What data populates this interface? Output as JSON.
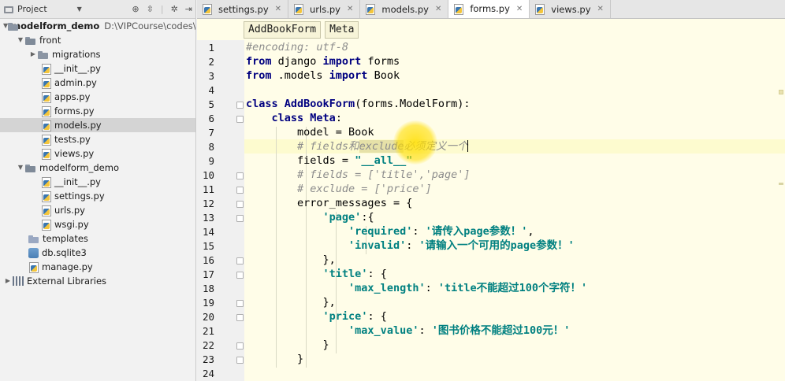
{
  "project_pane": {
    "title": "Project",
    "tree": [
      {
        "label": "modelform_demo",
        "path": "D:\\VIPCourse\\codes\\py",
        "kind": "root",
        "expanded": true
      },
      {
        "label": "front",
        "kind": "package",
        "expanded": true
      },
      {
        "label": "migrations",
        "kind": "folder",
        "expanded": false
      },
      {
        "label": "__init__.py",
        "kind": "py"
      },
      {
        "label": "admin.py",
        "kind": "py"
      },
      {
        "label": "apps.py",
        "kind": "py"
      },
      {
        "label": "forms.py",
        "kind": "py"
      },
      {
        "label": "models.py",
        "kind": "py",
        "selected": true
      },
      {
        "label": "tests.py",
        "kind": "py"
      },
      {
        "label": "views.py",
        "kind": "py"
      },
      {
        "label": "modelform_demo",
        "kind": "package",
        "expanded": true
      },
      {
        "label": "__init__.py",
        "kind": "py"
      },
      {
        "label": "settings.py",
        "kind": "py"
      },
      {
        "label": "urls.py",
        "kind": "py"
      },
      {
        "label": "wsgi.py",
        "kind": "py"
      },
      {
        "label": "templates",
        "kind": "folder-plain"
      },
      {
        "label": "db.sqlite3",
        "kind": "db"
      },
      {
        "label": "manage.py",
        "kind": "py"
      },
      {
        "label": "External Libraries",
        "kind": "libs",
        "expanded": false
      }
    ]
  },
  "tabs": [
    {
      "label": "settings.py",
      "active": false
    },
    {
      "label": "urls.py",
      "active": false
    },
    {
      "label": "models.py",
      "active": false
    },
    {
      "label": "forms.py",
      "active": true
    },
    {
      "label": "views.py",
      "active": false
    }
  ],
  "breadcrumb": [
    "AddBookForm",
    "Meta"
  ],
  "editor": {
    "line_numbers": [
      "1",
      "2",
      "3",
      "4",
      "5",
      "6",
      "7",
      "8",
      "9",
      "10",
      "11",
      "12",
      "13",
      "14",
      "15",
      "16",
      "17",
      "18",
      "19",
      "20",
      "21",
      "22",
      "23",
      "24"
    ],
    "lines": [
      "#encoding: utf-8",
      "from django import forms",
      "from .models import Book",
      "",
      "class AddBookForm(forms.ModelForm):",
      "    class Meta:",
      "        model = Book",
      "        # fields和exclude必须定义一个",
      "        fields = \"__all__\"",
      "        # fields = ['title','page']",
      "        # exclude = ['price']",
      "        error_messages = {",
      "            'page':{",
      "                'required': '请传入page参数！',",
      "                'invalid': '请输入一个可用的page参数！'",
      "            },",
      "            'title': {",
      "                'max_length': 'title不能超过100个字符！'",
      "            },",
      "            'price': {",
      "                'max_value': '图书价格不能超过100元！'",
      "            }",
      "        }",
      ""
    ],
    "tokens": {
      "l1_comment": "#encoding: utf-8",
      "kw_from": "from",
      "kw_import": "import",
      "kw_class": "class",
      "mod_django": " django ",
      "mod_forms": " forms",
      "mod_models": " .models ",
      "name_book": " Book",
      "class_name": "AddBookForm",
      "base_class": "(forms.ModelForm):",
      "meta_name": "Meta",
      "colon": ":",
      "model_assign": "model = Book",
      "l8_comment_a": "# fields和",
      "l8_comment_b": "exclude",
      "l8_comment_c": "必须定义一个",
      "fields_assign": "fields = ",
      "fields_value": "\"__all__\"",
      "l10_comment": "# fields = ['title','page']",
      "l11_comment": "# exclude = ['price']",
      "err_assign": "error_messages = {",
      "k_page": "'page'",
      "open_a": ":{",
      "k_required": "'required'",
      "v_required": "'请传入page参数！'",
      "k_invalid": "'invalid'",
      "v_invalid": "'请输入一个可用的page参数！'",
      "close_brace_comma": "},",
      "k_title": "'title'",
      "open_b": ": {",
      "k_max_length": "'max_length'",
      "v_max_length": "'title不能超过100个字符！'",
      "k_price": "'price'",
      "k_max_value": "'max_value'",
      "v_max_value": "'图书价格不能超过100元！'",
      "close_brace": "}",
      "sep": ": ",
      "comma": ","
    }
  }
}
